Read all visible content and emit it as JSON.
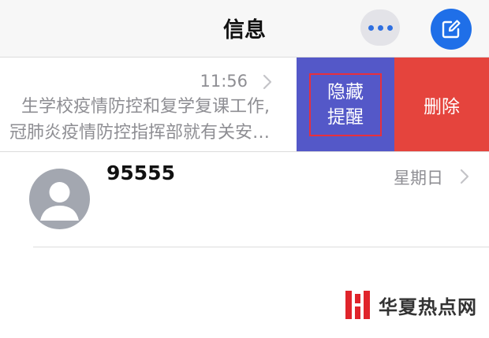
{
  "header": {
    "title": "信息",
    "more_icon": "ellipsis-icon",
    "compose_icon": "compose-icon",
    "accent_color": "#1f6fe8"
  },
  "conversations": [
    {
      "time": "11:56",
      "preview_lines": [
        "生学校疫情防控和复学复课工作,",
        "冠肺炎疫情防控指挥部就有关安…"
      ],
      "actions": {
        "hide_alerts_lines": [
          "隐藏",
          "提醒"
        ],
        "delete": "删除"
      }
    },
    {
      "sender": "95555",
      "time": "星期日",
      "avatar_icon": "person-icon"
    }
  ],
  "watermark": {
    "text": "华夏热点网",
    "logo_icon": "logo-icon"
  }
}
